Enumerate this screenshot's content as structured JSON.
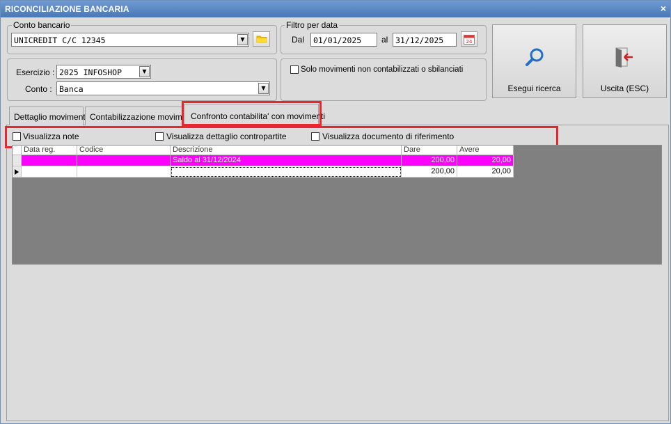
{
  "window": {
    "title": "RICONCILIAZIONE BANCARIA",
    "close_glyph": "×"
  },
  "conto_bancario": {
    "legend": "Conto bancario",
    "value": "UNICREDIT C/C 12345"
  },
  "filtro_data": {
    "legend": "Filtro per data",
    "dal_label": "Dal",
    "dal_value": "01/01/2025",
    "al_label": "al",
    "al_value": "31/12/2025",
    "calendar_day": "24"
  },
  "esercizio": {
    "label": "Esercizio :",
    "value": "2025 INFOSHOP"
  },
  "conto": {
    "label": "Conto :",
    "value": "Banca"
  },
  "solo_movimenti": {
    "label": "Solo movimenti non contabilizzati o sbilanciati",
    "checked": false
  },
  "buttons": {
    "search": "Esegui ricerca",
    "exit": "Uscita (ESC)"
  },
  "tabs": [
    {
      "label": "Dettaglio movimenti"
    },
    {
      "label": "Contabilizzazione movimenti"
    },
    {
      "label": "Confronto contabilita' con movimenti",
      "active": true
    }
  ],
  "options": [
    {
      "label": "Visualizza note",
      "checked": false
    },
    {
      "label": "Visualizza dettaglio contropartite",
      "checked": false
    },
    {
      "label": "Visualizza documento di riferimento",
      "checked": false
    }
  ],
  "grid": {
    "columns": [
      "Data reg.",
      "Codice",
      "Descrizione",
      "Dare",
      "Avere"
    ],
    "rows": [
      {
        "data": "",
        "codice": "",
        "descrizione": "Saldo al 31/12/2024",
        "dare": "200,00",
        "avere": "20,00",
        "highlight": "#ff00ff"
      },
      {
        "data": "",
        "codice": "",
        "descrizione": "",
        "dare": "200,00",
        "avere": "20,00"
      }
    ]
  },
  "colors": {
    "title_bar": "#4a78b6",
    "highlight": "#e8262c",
    "row_highlight": "#ff00ff",
    "grid_bg": "#808080"
  },
  "icons": [
    "close-icon",
    "folder-icon",
    "calendar-icon",
    "magnifier-icon",
    "exit-door-icon",
    "chevron-down-icon",
    "row-pointer-icon"
  ]
}
